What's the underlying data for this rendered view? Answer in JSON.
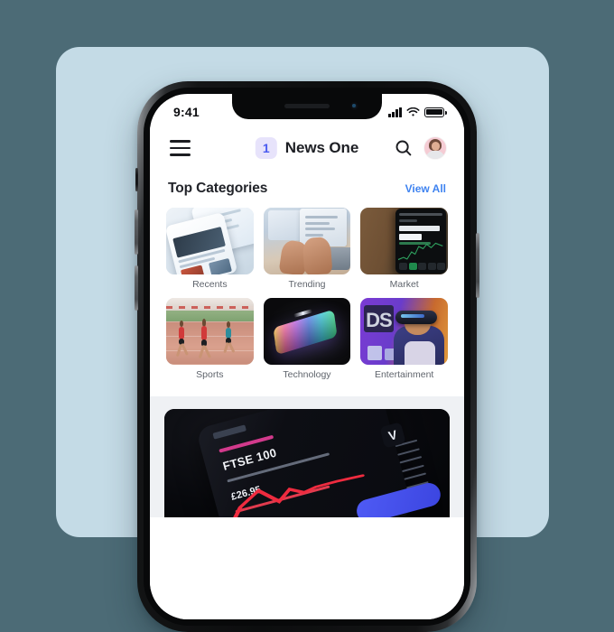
{
  "background": {
    "page_color": "#4c6b76",
    "card_color": "#c4dbe6"
  },
  "phone": {
    "statusbar": {
      "time": "9:41",
      "signal_icon": "cellular-signal-icon",
      "wifi_icon": "wifi-icon",
      "battery_icon": "battery-full-icon"
    },
    "appbar": {
      "menu_icon": "hamburger-menu-icon",
      "badge_number": "1",
      "title": "News One",
      "search_icon": "search-icon",
      "avatar_icon": "user-avatar"
    },
    "categories": {
      "title": "Top Categories",
      "view_all_label": "View All",
      "view_all_color": "#3f83f0",
      "items": [
        {
          "label": "Recents",
          "art": "recents"
        },
        {
          "label": "Trending",
          "art": "trending"
        },
        {
          "label": "Market",
          "art": "market"
        },
        {
          "label": "Sports",
          "art": "sports"
        },
        {
          "label": "Technology",
          "art": "technology"
        },
        {
          "label": "Entertainment",
          "art": "entertainment"
        }
      ]
    },
    "featured": {
      "art_name": "ftse-100-stock-phone-photo",
      "headline": "FTSE 100",
      "price": "£26.95",
      "app_mark": "V"
    }
  }
}
